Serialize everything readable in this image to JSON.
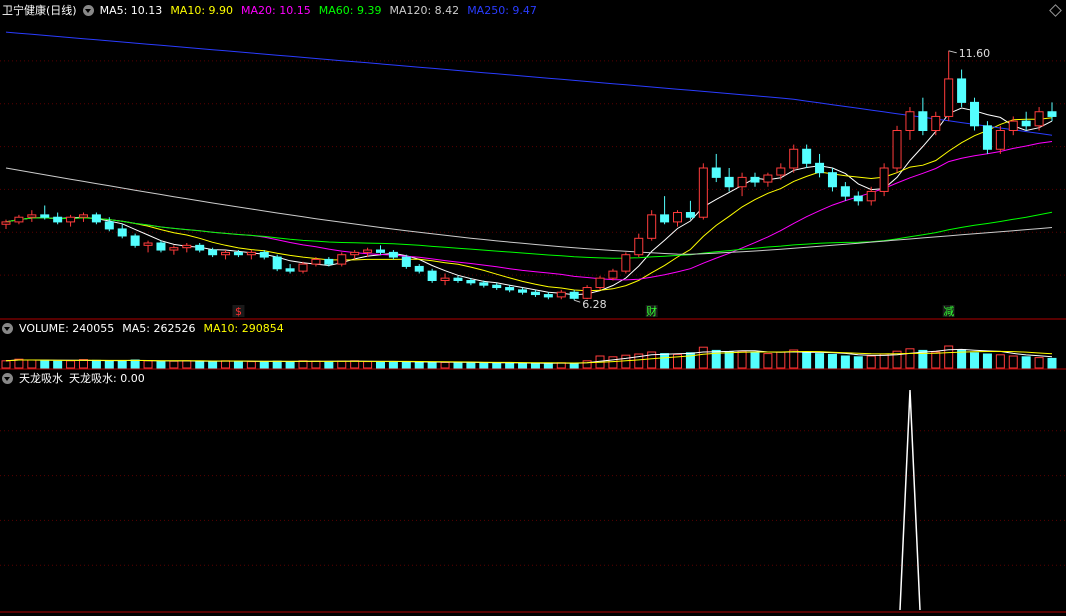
{
  "price_header": {
    "stock_name": "卫宁健康(日线)",
    "items": [
      {
        "label": "MA5: 10.13",
        "color": "#ffffff"
      },
      {
        "label": "MA10: 9.90",
        "color": "#ffff00"
      },
      {
        "label": "MA20: 10.15",
        "color": "#ff00ff"
      },
      {
        "label": "MA60: 9.39",
        "color": "#00ff00"
      },
      {
        "label": "MA120: 8.42",
        "color": "#cccccc"
      },
      {
        "label": "MA250: 9.47",
        "color": "#2a3cff"
      }
    ]
  },
  "volume_header": {
    "items": [
      {
        "label": "VOLUME: 240055",
        "color": "#ffffff"
      },
      {
        "label": "MA5: 262526",
        "color": "#ffffff"
      },
      {
        "label": "MA10: 290854",
        "color": "#ffff00"
      }
    ]
  },
  "indicator_header": {
    "name": "天龙吸水",
    "value_label": "天龙吸水: 0.00"
  },
  "annotations": {
    "high_label": "11.60",
    "low_label": "6.28",
    "markers": [
      {
        "text": "$",
        "color": "#ff3030"
      },
      {
        "text": "财",
        "color": "#30ff30"
      },
      {
        "text": "减",
        "color": "#30ff30"
      }
    ]
  },
  "colors": {
    "up": "#ff3c3c",
    "down": "#54ffff",
    "grid": "#5a0000",
    "divider": "#b00000"
  },
  "chart_data": {
    "type": "candlestick",
    "price_range": [
      5.9,
      12.3
    ],
    "candles": [
      [
        7.9,
        8.0,
        7.8,
        7.95
      ],
      [
        7.95,
        8.1,
        7.9,
        8.05
      ],
      [
        8.05,
        8.2,
        7.95,
        8.1
      ],
      [
        8.1,
        8.3,
        8.0,
        8.05
      ],
      [
        8.05,
        8.15,
        7.9,
        7.95
      ],
      [
        7.95,
        8.1,
        7.85,
        8.05
      ],
      [
        8.05,
        8.15,
        7.95,
        8.1
      ],
      [
        8.1,
        8.15,
        7.9,
        7.95
      ],
      [
        7.95,
        8.05,
        7.75,
        7.8
      ],
      [
        7.8,
        7.9,
        7.6,
        7.65
      ],
      [
        7.65,
        7.7,
        7.4,
        7.45
      ],
      [
        7.45,
        7.55,
        7.3,
        7.5
      ],
      [
        7.5,
        7.55,
        7.3,
        7.35
      ],
      [
        7.35,
        7.45,
        7.25,
        7.4
      ],
      [
        7.4,
        7.5,
        7.3,
        7.45
      ],
      [
        7.45,
        7.5,
        7.3,
        7.35
      ],
      [
        7.35,
        7.4,
        7.2,
        7.25
      ],
      [
        7.25,
        7.35,
        7.15,
        7.3
      ],
      [
        7.3,
        7.35,
        7.2,
        7.25
      ],
      [
        7.25,
        7.35,
        7.15,
        7.3
      ],
      [
        7.3,
        7.35,
        7.15,
        7.2
      ],
      [
        7.2,
        7.25,
        6.9,
        6.95
      ],
      [
        6.95,
        7.05,
        6.85,
        6.9
      ],
      [
        6.9,
        7.1,
        6.85,
        7.05
      ],
      [
        7.05,
        7.2,
        7.0,
        7.15
      ],
      [
        7.15,
        7.2,
        7.0,
        7.05
      ],
      [
        7.05,
        7.3,
        7.0,
        7.25
      ],
      [
        7.25,
        7.35,
        7.15,
        7.3
      ],
      [
        7.3,
        7.4,
        7.2,
        7.35
      ],
      [
        7.35,
        7.45,
        7.25,
        7.3
      ],
      [
        7.3,
        7.35,
        7.15,
        7.2
      ],
      [
        7.2,
        7.25,
        6.95,
        7.0
      ],
      [
        7.0,
        7.05,
        6.85,
        6.9
      ],
      [
        6.9,
        6.95,
        6.65,
        6.7
      ],
      [
        6.7,
        6.85,
        6.6,
        6.75
      ],
      [
        6.75,
        6.8,
        6.65,
        6.7
      ],
      [
        6.7,
        6.75,
        6.6,
        6.65
      ],
      [
        6.65,
        6.7,
        6.55,
        6.6
      ],
      [
        6.6,
        6.65,
        6.5,
        6.55
      ],
      [
        6.55,
        6.6,
        6.45,
        6.5
      ],
      [
        6.5,
        6.55,
        6.4,
        6.45
      ],
      [
        6.45,
        6.5,
        6.35,
        6.4
      ],
      [
        6.4,
        6.45,
        6.3,
        6.35
      ],
      [
        6.35,
        6.5,
        6.3,
        6.45
      ],
      [
        6.45,
        6.5,
        6.28,
        6.32
      ],
      [
        6.32,
        6.6,
        6.3,
        6.55
      ],
      [
        6.55,
        6.8,
        6.5,
        6.75
      ],
      [
        6.75,
        6.95,
        6.7,
        6.9
      ],
      [
        6.9,
        7.3,
        6.85,
        7.25
      ],
      [
        7.25,
        7.7,
        7.2,
        7.6
      ],
      [
        7.6,
        8.2,
        7.55,
        8.1
      ],
      [
        8.1,
        8.5,
        7.9,
        7.95
      ],
      [
        7.95,
        8.2,
        7.85,
        8.15
      ],
      [
        8.15,
        8.4,
        8.0,
        8.05
      ],
      [
        8.05,
        9.2,
        8.0,
        9.1
      ],
      [
        9.1,
        9.4,
        8.8,
        8.9
      ],
      [
        8.9,
        9.1,
        8.6,
        8.7
      ],
      [
        8.7,
        9.0,
        8.5,
        8.9
      ],
      [
        8.9,
        9.0,
        8.7,
        8.8
      ],
      [
        8.8,
        9.0,
        8.7,
        8.95
      ],
      [
        8.95,
        9.2,
        8.85,
        9.1
      ],
      [
        9.1,
        9.6,
        9.0,
        9.5
      ],
      [
        9.5,
        9.6,
        9.1,
        9.2
      ],
      [
        9.2,
        9.4,
        8.9,
        9.0
      ],
      [
        9.0,
        9.1,
        8.6,
        8.7
      ],
      [
        8.7,
        8.8,
        8.4,
        8.5
      ],
      [
        8.5,
        8.6,
        8.3,
        8.4
      ],
      [
        8.4,
        8.7,
        8.3,
        8.6
      ],
      [
        8.6,
        9.2,
        8.5,
        9.1
      ],
      [
        9.1,
        10.0,
        9.0,
        9.9
      ],
      [
        9.9,
        10.4,
        9.7,
        10.3
      ],
      [
        10.3,
        10.6,
        9.8,
        9.9
      ],
      [
        9.9,
        10.3,
        9.8,
        10.2
      ],
      [
        10.2,
        11.6,
        10.1,
        11.0
      ],
      [
        11.0,
        11.2,
        10.4,
        10.5
      ],
      [
        10.5,
        10.6,
        9.9,
        10.0
      ],
      [
        10.0,
        10.1,
        9.4,
        9.5
      ],
      [
        9.5,
        10.0,
        9.4,
        9.9
      ],
      [
        9.9,
        10.2,
        9.8,
        10.1
      ],
      [
        10.1,
        10.3,
        9.9,
        10.0
      ],
      [
        10.0,
        10.4,
        9.9,
        10.3
      ],
      [
        10.3,
        10.5,
        10.1,
        10.2
      ]
    ],
    "volumes": [
      18,
      22,
      20,
      19,
      17,
      18,
      21,
      19,
      17,
      18,
      20,
      18,
      16,
      17,
      18,
      17,
      16,
      18,
      17,
      16,
      15,
      17,
      16,
      18,
      17,
      16,
      17,
      18,
      16,
      15,
      16,
      15,
      14,
      15,
      14,
      13,
      14,
      13,
      12,
      13,
      12,
      11,
      12,
      13,
      12,
      18,
      30,
      28,
      32,
      35,
      40,
      36,
      34,
      38,
      52,
      44,
      40,
      42,
      38,
      36,
      40,
      45,
      38,
      36,
      34,
      30,
      28,
      30,
      35,
      42,
      48,
      44,
      40,
      55,
      46,
      38,
      35,
      33,
      30,
      28,
      26,
      24
    ],
    "vol_range": [
      0,
      80
    ],
    "indicator": {
      "range": [
        0,
        1
      ],
      "values_note": "single spike near candle index 70",
      "spike_index": 70,
      "spike_value": 1
    }
  }
}
